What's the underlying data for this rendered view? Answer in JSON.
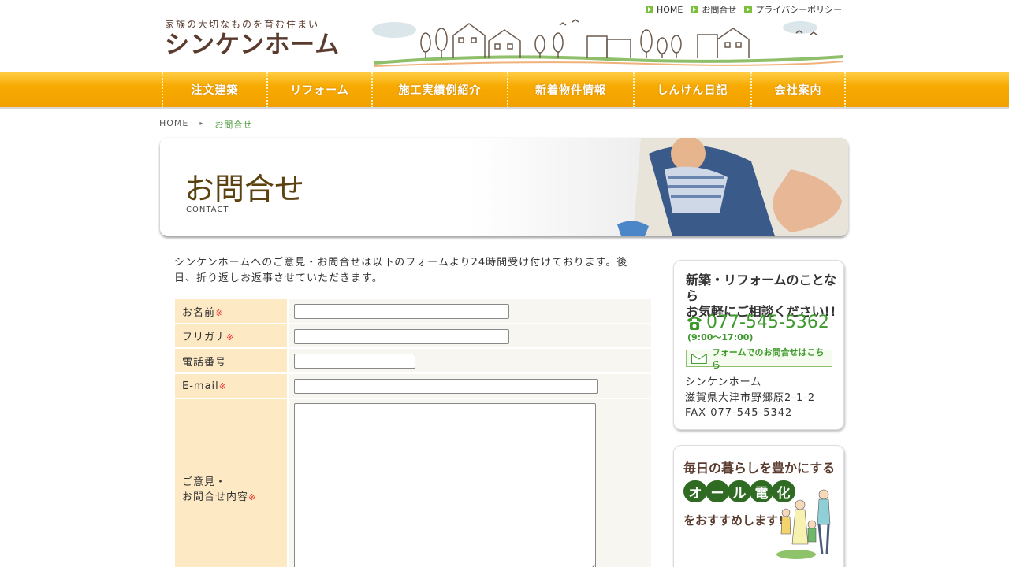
{
  "header": {
    "tagline": "家族の大切なものを育む住まい",
    "logo": "シンケンホーム",
    "top_links": [
      "HOME",
      "お問合せ",
      "プライバシーポリシー"
    ]
  },
  "nav": [
    "注文建築",
    "リフォーム",
    "施工実績例紹介",
    "新着物件情報",
    "しんけん日記",
    "会社案内"
  ],
  "breadcrumb": {
    "home": "HOME",
    "arrow": "▸",
    "current": "お問合せ"
  },
  "hero": {
    "title": "お問合せ",
    "subtitle": "CONTACT"
  },
  "intro": "シンケンホームへのご意見・お問合せは以下のフォームより24時間受け付けております。後日、折り返しお返事させていただきます。",
  "form": {
    "required_mark": "※",
    "name_label": "お名前",
    "kana_label": "フリガナ",
    "tel_label": "電話番号",
    "email_label": "E-mail",
    "msg_label_1": "ご意見・",
    "msg_label_2": "お問合せ内容"
  },
  "sidebar": {
    "contact": {
      "head1": "新築・リフォームのことなら",
      "head2": "お気軽にご相談ください!!",
      "tel": "077-545-5362",
      "hours": "(9:00〜17:00)",
      "form_button": "フォームでのお問合せはこちら",
      "company": "シンケンホーム",
      "address": "滋賀県大津市野郷原2-1-2",
      "fax": "FAX 077-545-5342"
    },
    "banner": {
      "line1": "毎日の暮らしを豊かにする",
      "badge": [
        "オ",
        "ー",
        "ル",
        "電",
        "化"
      ],
      "line3": "をおすすめします!"
    }
  },
  "colors": {
    "nav": "#f7aa00",
    "label_bg": "#fde9c4",
    "accent_green": "#3c9a2a",
    "brown": "#5a3b2e"
  }
}
